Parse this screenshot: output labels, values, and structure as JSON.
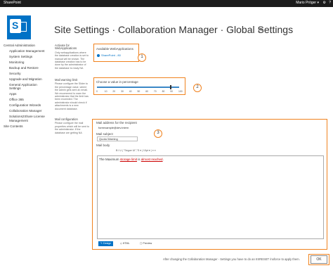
{
  "topbar": {
    "brand": "SharePoint",
    "user": "Mario Pröger ▾",
    "settings_glyph": "⚙",
    "help_glyph": "?"
  },
  "page": {
    "title": "Site Settings · Collaboration Manager · Global Settings"
  },
  "leftnav": {
    "items": [
      {
        "label": "Central Administration",
        "sub": false
      },
      {
        "label": "Application Management",
        "sub": true
      },
      {
        "label": "System Settings",
        "sub": true
      },
      {
        "label": "Monitoring",
        "sub": true
      },
      {
        "label": "Backup and Restore",
        "sub": true
      },
      {
        "label": "Security",
        "sub": true
      },
      {
        "label": "Upgrade and Migration",
        "sub": true
      },
      {
        "label": "General Application Settings",
        "sub": true
      },
      {
        "label": "Apps",
        "sub": true
      },
      {
        "label": "Office 365",
        "sub": true
      },
      {
        "label": "Configuration Wizards",
        "sub": true
      },
      {
        "label": "Collaboration Manager",
        "sub": true
      },
      {
        "label": "Solutions2Share License Management",
        "sub": true
      },
      {
        "label": "Site Contents",
        "sub": false
      }
    ]
  },
  "section1": {
    "heading": "Activate for WebApplications",
    "desc": "Only webapplications where the database creation is set to manual will be shown. The database creation has to be done by the administrator of the database is ready NA",
    "label": "Available WebApplications",
    "option": "SharePoint - 80",
    "badge": "1"
  },
  "section2": {
    "heading": "Mail warning limit",
    "desc": "Please configure the Slider to the percentage value, where the admin gets sent an email. We recommend to warn the administrator that the limit has been exceeded. The administrator should check if attachments is a new document database.",
    "label": "Choose a value in percentage",
    "value_percent": 90,
    "ticks": [
      "0",
      "10",
      "20",
      "30",
      "40",
      "50",
      "60",
      "70",
      "80",
      "90",
      "100"
    ],
    "badge": "2"
  },
  "section3": {
    "heading": "Mail configuration",
    "desc": "Please configure the mail properties which will be sent to the administrator. If the database are getting NA",
    "recipient_label": "Mail address for the recipient",
    "recipient_value": "foreexample@dev.intern",
    "subject_label": "Mail subject",
    "subject_value": "Quota Warning",
    "body_label": "Mail body",
    "toolbar": "B  I  U  |  \"Segoe UI\",\"S ▾  |  10pt ▾  |  ≡  ≡",
    "body_text_before": "The Maximum ",
    "body_err1": "storage limit",
    "body_mid": " is ",
    "body_err2": "almost reached",
    "body_end": ".",
    "tab_design": "✎ Design",
    "tab_html": "◇ HTML",
    "tab_preview": "▢ Preview",
    "badge": "3"
  },
  "footer": {
    "note": "After changing the Collaboration Manager - Settings you have to do an IISRESET /noforce to apply them.",
    "ok": "OK"
  },
  "colors": {
    "accent": "#f0821e",
    "brand": "#0072c6"
  }
}
